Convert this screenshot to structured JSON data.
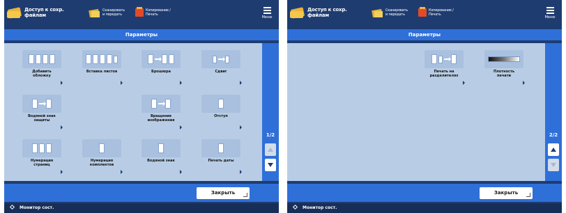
{
  "header": {
    "file_access_label": "Доступ к сохр.\nфайлам",
    "scan_label": "Сканировать\nи передать",
    "copy_label": "Копирование /\nПечать",
    "menu_label": "Меню"
  },
  "screen_title": "Параметры",
  "close_label": "Закрыть",
  "status_monitor_label": "Монитор сост.",
  "page1": {
    "page_indicator": "1/2",
    "options": [
      {
        "label": "Добавить\nобложку"
      },
      {
        "label": "Вставка листов"
      },
      {
        "label": "Брошюра"
      },
      {
        "label": "Сдвиг"
      },
      {
        "label": "Водяной знак\nзащиты"
      },
      {
        "label": "Вращение\nизображения"
      },
      {
        "label": "Отступ"
      },
      {
        "label": "Нумерация\nстраниц"
      },
      {
        "label": "Нумерация\nкомплектов"
      },
      {
        "label": "Водяной знак"
      },
      {
        "label": "Печать даты"
      }
    ]
  },
  "page2": {
    "page_indicator": "2/2",
    "options": [
      {
        "label": "Печать на\nразделителях"
      },
      {
        "label": "Плотность\nпечати"
      }
    ]
  },
  "colors": {
    "frame": "#1e3c70",
    "bar": "#2f6fd8",
    "content": "#b8cde5"
  }
}
